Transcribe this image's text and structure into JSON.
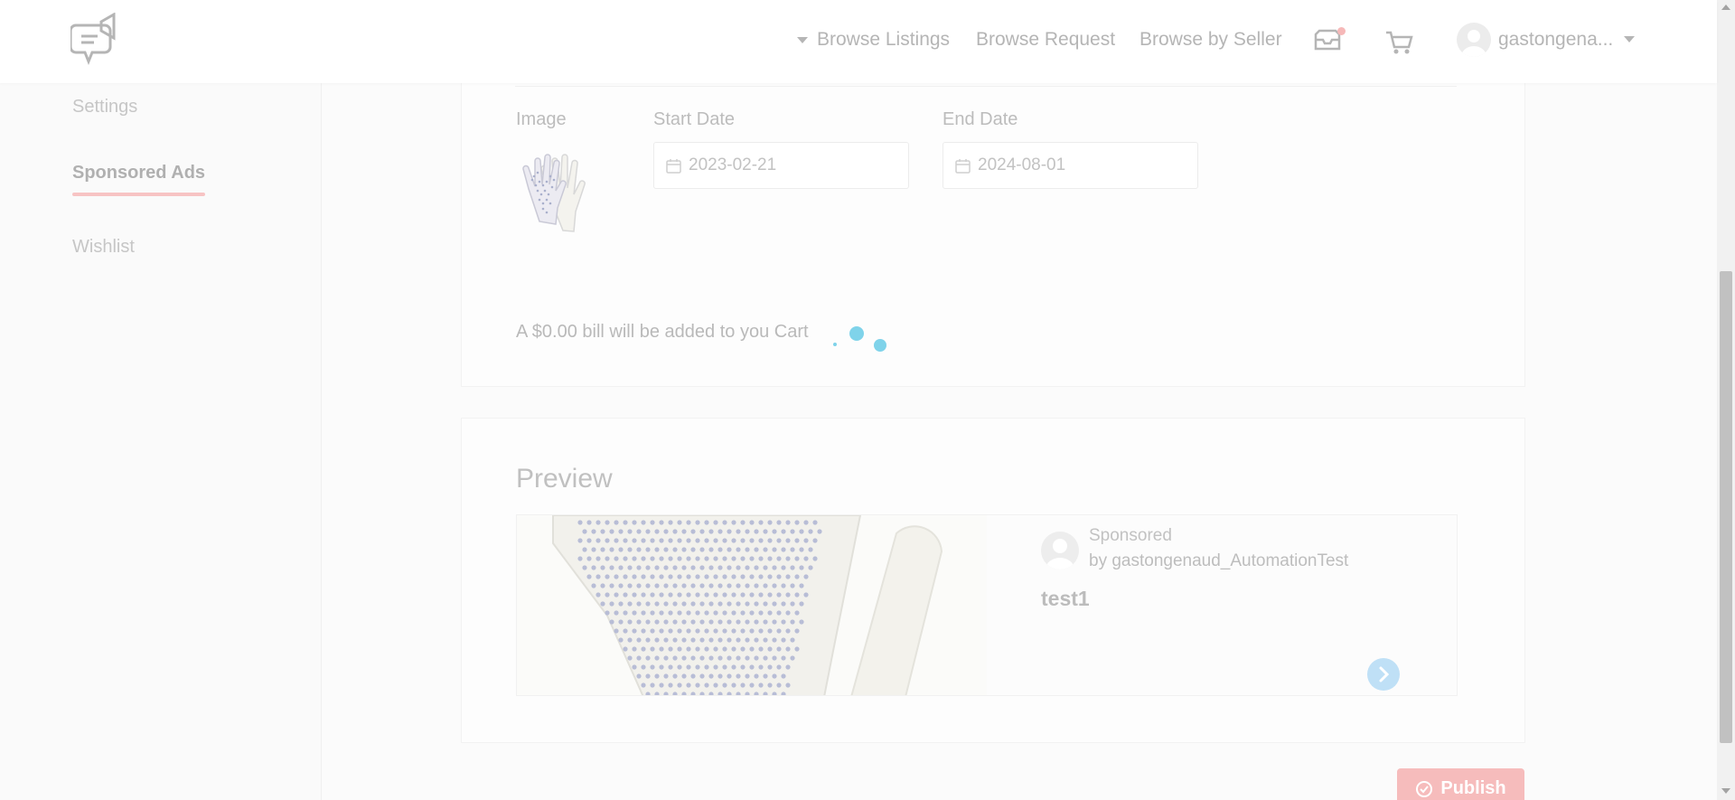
{
  "header": {
    "nav": {
      "browse_listings": "Browse Listings",
      "browse_request": "Browse Request",
      "browse_by_seller": "Browse by Seller"
    },
    "user_name": "gastongena..."
  },
  "sidebar": {
    "items": [
      {
        "label": "Settings"
      },
      {
        "label": "Sponsored Ads",
        "active": true
      },
      {
        "label": "Wishlist"
      }
    ]
  },
  "form": {
    "image_label": "Image",
    "start_date_label": "Start Date",
    "start_date_value": "2023-02-21",
    "end_date_label": "End Date",
    "end_date_value": "2024-08-01",
    "bill_text": "A $0.00 bill will be added to you Cart"
  },
  "preview": {
    "title": "Preview",
    "sponsored": "Sponsored",
    "by_line": "by gastongenaud_AutomationTest",
    "ad_title": "test1"
  },
  "publish_label": "Publish",
  "colors": {
    "accent_pink": "#f6bcbc",
    "spinner": "#7fd3ea",
    "next_button": "#bfe0f6"
  }
}
